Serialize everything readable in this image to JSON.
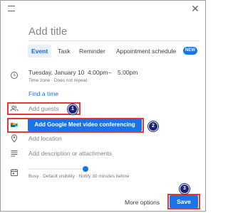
{
  "header": {
    "drag_icon": "drag-handle-icon",
    "close_icon": "close-icon",
    "close_glyph": "✕"
  },
  "title": {
    "placeholder": "Add title"
  },
  "tabs": [
    {
      "label": "Event",
      "active": true
    },
    {
      "label": "Task",
      "active": false
    },
    {
      "label": "Reminder",
      "active": false
    },
    {
      "label": "Appointment schedule",
      "active": false
    }
  ],
  "new_badge": "NEW",
  "datetime": {
    "date": "Tuesday, January 10",
    "start": "4:00pm",
    "separator": "–",
    "end": "5:00pm",
    "details": "Time zone · Does not repeat"
  },
  "find_time": "Find a time",
  "guests": {
    "placeholder": "Add guests"
  },
  "meet": {
    "label": "Add Google Meet video conferencing"
  },
  "location": {
    "placeholder": "Add location"
  },
  "description": {
    "placeholder": "Add description or attachments"
  },
  "calendar": {
    "status": "Busy · Default visibility · Notify 30 minutes before"
  },
  "footer": {
    "more_options": "More options",
    "save": "Save"
  },
  "steps": [
    "1",
    "2",
    "3"
  ],
  "colors": {
    "accent": "#1a73e8",
    "highlight_border": "#e53935",
    "step_badge": "#1a237e"
  }
}
